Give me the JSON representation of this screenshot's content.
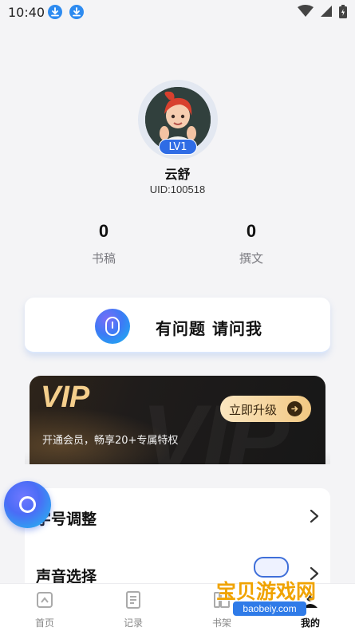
{
  "status_bar": {
    "time": "10:40",
    "icons": [
      "download-icon",
      "download-icon",
      "wifi-icon",
      "signal-icon",
      "battery-icon"
    ]
  },
  "profile": {
    "level": "LV1",
    "username": "云舒",
    "uid": "UID:100518"
  },
  "stats": [
    {
      "value": "0",
      "label": "书稿"
    },
    {
      "value": "0",
      "label": "撰文"
    }
  ],
  "ask_card": {
    "label": "有问题 请问我",
    "icon": "microphone-icon"
  },
  "vip": {
    "logo": "VIP",
    "watermark": "VIP",
    "description": "开通会员，畅享20+专属特权",
    "button_label": "立即升级"
  },
  "settings": [
    {
      "label": "字号调整"
    },
    {
      "label": "声音选择"
    }
  ],
  "tabs": [
    {
      "label": "首页",
      "icon": "home-icon",
      "active": false
    },
    {
      "label": "记录",
      "icon": "record-icon",
      "active": false
    },
    {
      "label": "书架",
      "icon": "bookshelf-icon",
      "active": false
    },
    {
      "label": "我的",
      "icon": "profile-icon",
      "active": true
    }
  ],
  "watermark_badge": {
    "title": "宝贝游戏网",
    "url": "baobeiy.com"
  },
  "colors": {
    "accent_blue": "#2f6ce5",
    "vip_gold": "#f5cf8c",
    "background": "#f4f4f6"
  }
}
